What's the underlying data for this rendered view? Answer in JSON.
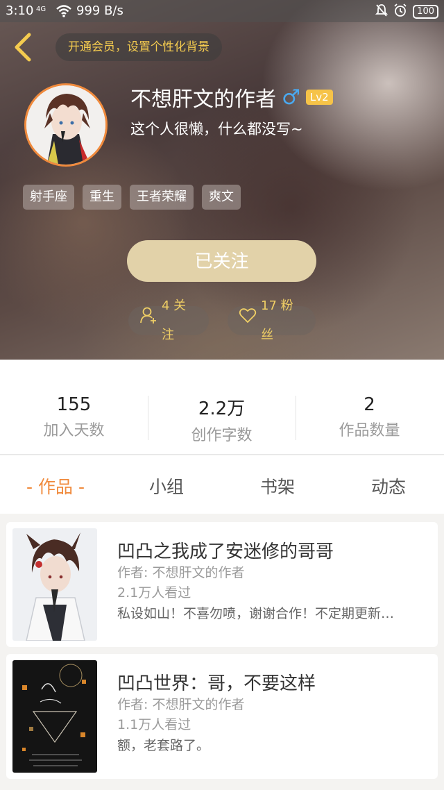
{
  "status_bar": {
    "time": "3:10",
    "signal": "4G",
    "speed": "999 B/s",
    "battery": "100"
  },
  "header": {
    "vip_label": "开通会员，设置个性化背景",
    "username": "不想肝文的作者",
    "gender_symbol": "♂",
    "level": "Lv2",
    "bio": "这个人很懒，什么都没写~",
    "tags": [
      "射手座",
      "重生",
      "王者荣耀",
      "爽文"
    ],
    "follow_button": "已关注",
    "following": "4 关注",
    "fans": "17 粉丝"
  },
  "stats": [
    {
      "value": "155",
      "label": "加入天数"
    },
    {
      "value": "2.2万",
      "label": "创作字数"
    },
    {
      "value": "2",
      "label": "作品数量"
    }
  ],
  "tabs": [
    "- 作品 -",
    "小组",
    "书架",
    "动态"
  ],
  "books": [
    {
      "title": "凹凸之我成了安迷修的哥哥",
      "author": "作者: 不想肝文的作者",
      "views": "2.1万人看过",
      "desc": "私设如山！不喜勿喷，谢谢合作！不定期更新…"
    },
    {
      "title": "凹凸世界：哥，不要这样",
      "author": "作者: 不想肝文的作者",
      "views": "1.1万人看过",
      "desc": "额，老套路了。"
    }
  ],
  "colors": {
    "accent": "#f08a3c",
    "gold": "#f4cb4f",
    "follow_btn": "#e2d2a9",
    "level_badge": "#f6c348",
    "male_blue": "#4aa9f0"
  }
}
